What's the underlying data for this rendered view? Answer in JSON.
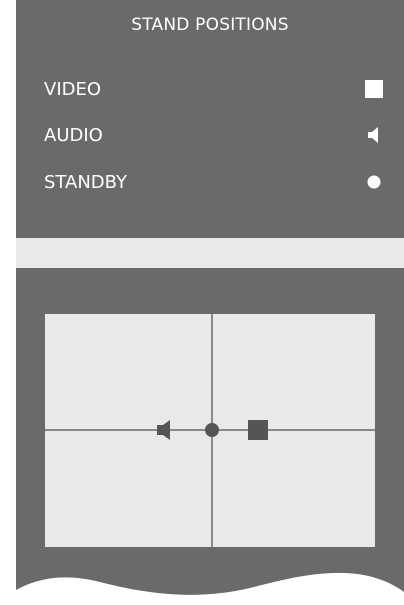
{
  "title": "STAND POSITIONS",
  "menu": {
    "items": [
      {
        "label": "VIDEO",
        "icon": "square-icon"
      },
      {
        "label": "AUDIO",
        "icon": "speaker-icon"
      },
      {
        "label": "STANDBY",
        "icon": "dot-icon"
      }
    ]
  },
  "colors": {
    "panel": "#6a6a6b",
    "text": "#ffffff",
    "stripe": "#e9e9e9",
    "diagram_bg": "#e9e9e9",
    "diagram_marks": "#555555",
    "diagram_lines": "#8a8a8a"
  }
}
